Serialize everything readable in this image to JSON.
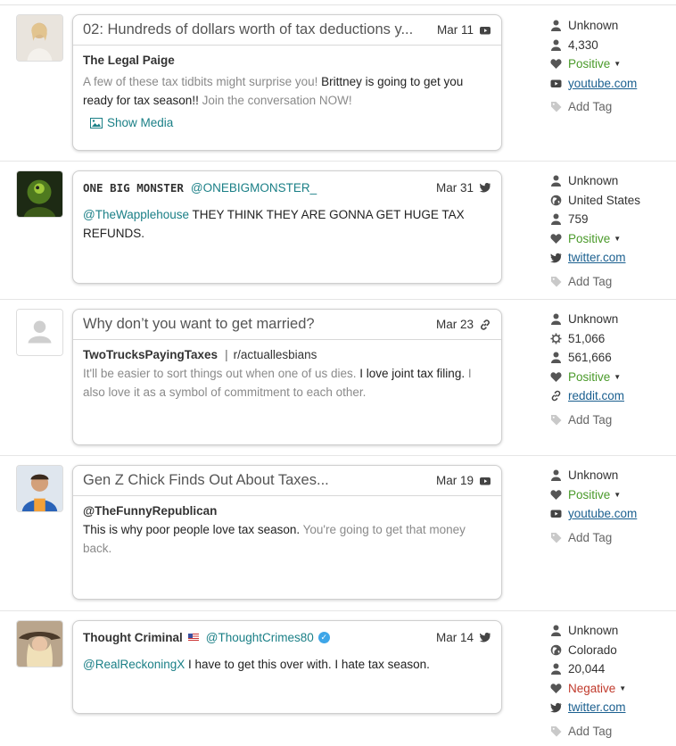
{
  "posts": [
    {
      "title": "02: Hundreds of dollars worth of tax deductions y...",
      "date": "Mar 11",
      "source_icon": "youtube-icon",
      "author": "The Legal Paige",
      "text_muted_1": "A few of these tax tidbits might surprise you! ",
      "text_strong_1": "Brittney is going to get you ready for tax season!! ",
      "text_muted_2": "Join the conversation NOW!",
      "show_media_label": "Show Media",
      "meta": {
        "gender": "Unknown",
        "followers": "4,330",
        "sentiment": "Positive",
        "domain": "youtube.com",
        "add_tag": "Add Tag"
      }
    },
    {
      "author_name": "ONE BIG MONSTER",
      "handle": "@ONEBIGMONSTER_",
      "date": "Mar 31",
      "source_icon": "twitter-icon",
      "mention": "@TheWapplehouse",
      "text": " THEY THINK THEY ARE GONNA GET HUGE TAX REFUNDS.",
      "meta": {
        "gender": "Unknown",
        "location": "United States",
        "followers": "759",
        "sentiment": "Positive",
        "domain": "twitter.com",
        "add_tag": "Add Tag"
      }
    },
    {
      "title": "Why don’t you want to get married?",
      "date": "Mar 23",
      "source_icon": "link-icon",
      "author": "TwoTrucksPayingTaxes",
      "separator": "|",
      "subreddit": "r/actuallesbians",
      "text_muted_1": "It'll be easier to sort things out when one of us dies. ",
      "text_strong_1": "I love joint tax filing.",
      "text_muted_2": " I also love it as a symbol of commitment to each other.",
      "meta": {
        "gender": "Unknown",
        "karma": "51,066",
        "followers": "561,666",
        "sentiment": "Positive",
        "domain": "reddit.com",
        "add_tag": "Add Tag"
      }
    },
    {
      "title": "Gen Z Chick Finds Out About Taxes...",
      "date": "Mar 19",
      "source_icon": "youtube-icon",
      "author": "@TheFunnyRepublican",
      "text_strong_1": "This is why poor people love tax season. ",
      "text_muted_1": "You're going to get that money back.",
      "meta": {
        "gender": "Unknown",
        "sentiment": "Positive",
        "domain": "youtube.com",
        "add_tag": "Add Tag"
      }
    },
    {
      "author_name": "Thought Criminal",
      "handle": "@ThoughtCrimes80",
      "date": "Mar 14",
      "source_icon": "twitter-icon",
      "mention": "@RealReckoningX",
      "text": " I have to get this over with. I hate tax season.",
      "meta": {
        "gender": "Unknown",
        "location": "Colorado",
        "followers": "20,044",
        "sentiment": "Negative",
        "domain": "twitter.com",
        "add_tag": "Add Tag"
      }
    }
  ],
  "colors": {
    "accent_teal": "#1a7f86",
    "positive": "#4a9a2a",
    "negative": "#c0392b",
    "link_blue": "#1a5f8f"
  }
}
